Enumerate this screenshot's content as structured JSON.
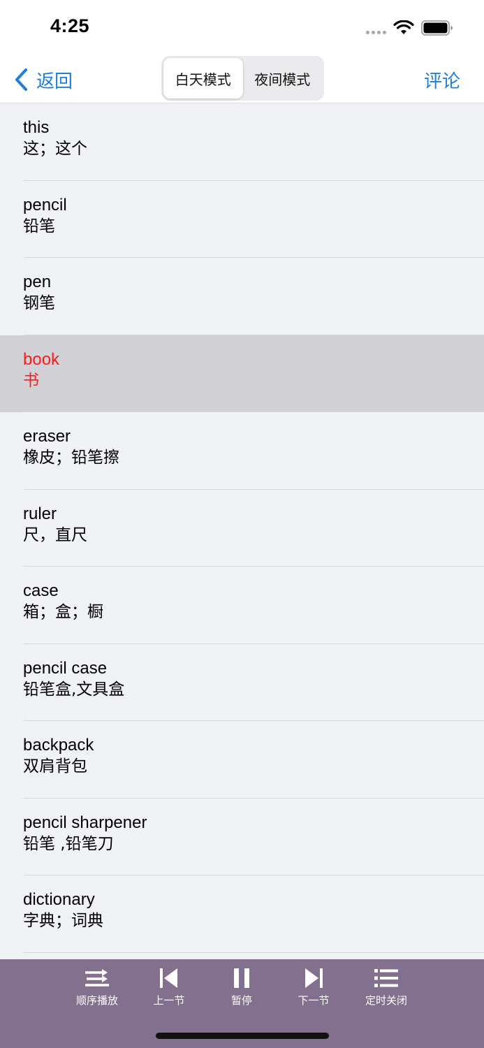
{
  "status_bar": {
    "time": "4:25"
  },
  "nav": {
    "back_label": "返回",
    "modes": [
      {
        "label": "白天模式",
        "active": true
      },
      {
        "label": "夜间模式",
        "active": false
      }
    ],
    "comment_label": "评论"
  },
  "words": [
    {
      "en": "this",
      "cn": "这；这个",
      "highlighted": false
    },
    {
      "en": "pencil",
      "cn": "铅笔",
      "highlighted": false
    },
    {
      "en": "pen",
      "cn": "钢笔",
      "highlighted": false
    },
    {
      "en": "book",
      "cn": "书",
      "highlighted": true
    },
    {
      "en": "eraser",
      "cn": "橡皮；铅笔擦",
      "highlighted": false
    },
    {
      "en": "ruler",
      "cn": "尺，直尺",
      "highlighted": false
    },
    {
      "en": "case",
      "cn": "箱；盒；橱",
      "highlighted": false
    },
    {
      "en": "pencil case",
      "cn": "铅笔盒,文具盒",
      "highlighted": false
    },
    {
      "en": "backpack",
      "cn": "双肩背包",
      "highlighted": false
    },
    {
      "en": "pencil sharpener",
      "cn": "铅笔 ,铅笔刀",
      "highlighted": false
    },
    {
      "en": "dictionary",
      "cn": "字典；词典",
      "highlighted": false
    }
  ],
  "player": {
    "sequence_label": "顺序播放",
    "prev_label": "上一节",
    "pause_label": "暂停",
    "next_label": "下一节",
    "timer_label": "定时关闭"
  },
  "colors": {
    "accent": "#1f7ce0",
    "highlight_text": "#ff1a1a",
    "highlight_row": "#d1d1d6",
    "player_bg": "#83708f",
    "list_bg": "#f1f2f5"
  },
  "icons": {
    "back": "chevron-left-icon",
    "wifi": "wifi-icon",
    "battery": "battery-icon",
    "sequence": "shuffle-arrows-icon",
    "prev": "skip-previous-icon",
    "pause": "pause-icon",
    "next": "skip-next-icon",
    "timer": "list-icon"
  }
}
